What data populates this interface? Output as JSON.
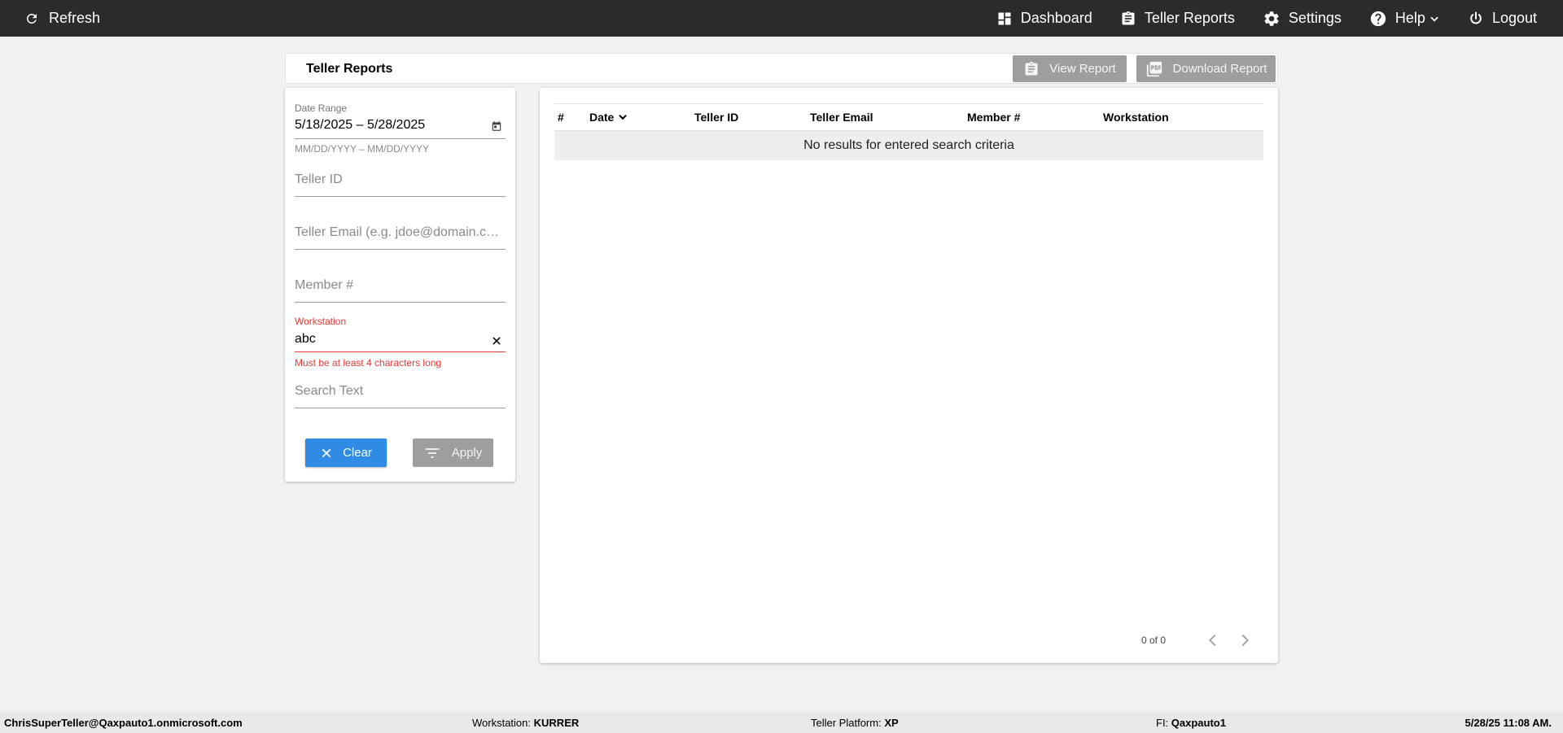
{
  "topbar": {
    "refresh_label": "Refresh",
    "nav": {
      "dashboard": "Dashboard",
      "teller_reports": "Teller Reports",
      "settings": "Settings",
      "help": "Help",
      "logout": "Logout"
    }
  },
  "header": {
    "title": "Teller Reports",
    "view_report": "View Report",
    "download_report": "Download Report"
  },
  "filters": {
    "date_range_label": "Date Range",
    "date_range_value": "5/18/2025 – 5/28/2025",
    "date_range_hint": "MM/DD/YYYY – MM/DD/YYYY",
    "teller_id_placeholder": "Teller ID",
    "teller_email_placeholder": "Teller Email (e.g. jdoe@domain.com)",
    "member_placeholder": "Member #",
    "workstation_label": "Workstation",
    "workstation_value": "abc",
    "workstation_error": "Must be at least 4 characters long",
    "search_text_placeholder": "Search Text",
    "clear_label": "Clear",
    "apply_label": "Apply"
  },
  "table": {
    "columns": [
      "#",
      "Date",
      "Teller ID",
      "Teller Email",
      "Member #",
      "Workstation"
    ],
    "empty_message": "No results for entered search criteria",
    "pager_text": "0 of 0"
  },
  "footer": {
    "user": "ChrisSuperTeller@Qaxpauto1.onmicrosoft.com",
    "workstation_label": "Workstation:",
    "workstation_value": "KURRER",
    "platform_label": "Teller Platform:",
    "platform_value": "XP",
    "fi_label": "FI:",
    "fi_value": "Qaxpauto1",
    "datetime": "5/28/25 11:08 AM."
  },
  "colors": {
    "topbar": "#2b2b2b",
    "primary_button": "#2f8be4",
    "disabled_button": "#9e9e9e",
    "error": "#e53935"
  }
}
